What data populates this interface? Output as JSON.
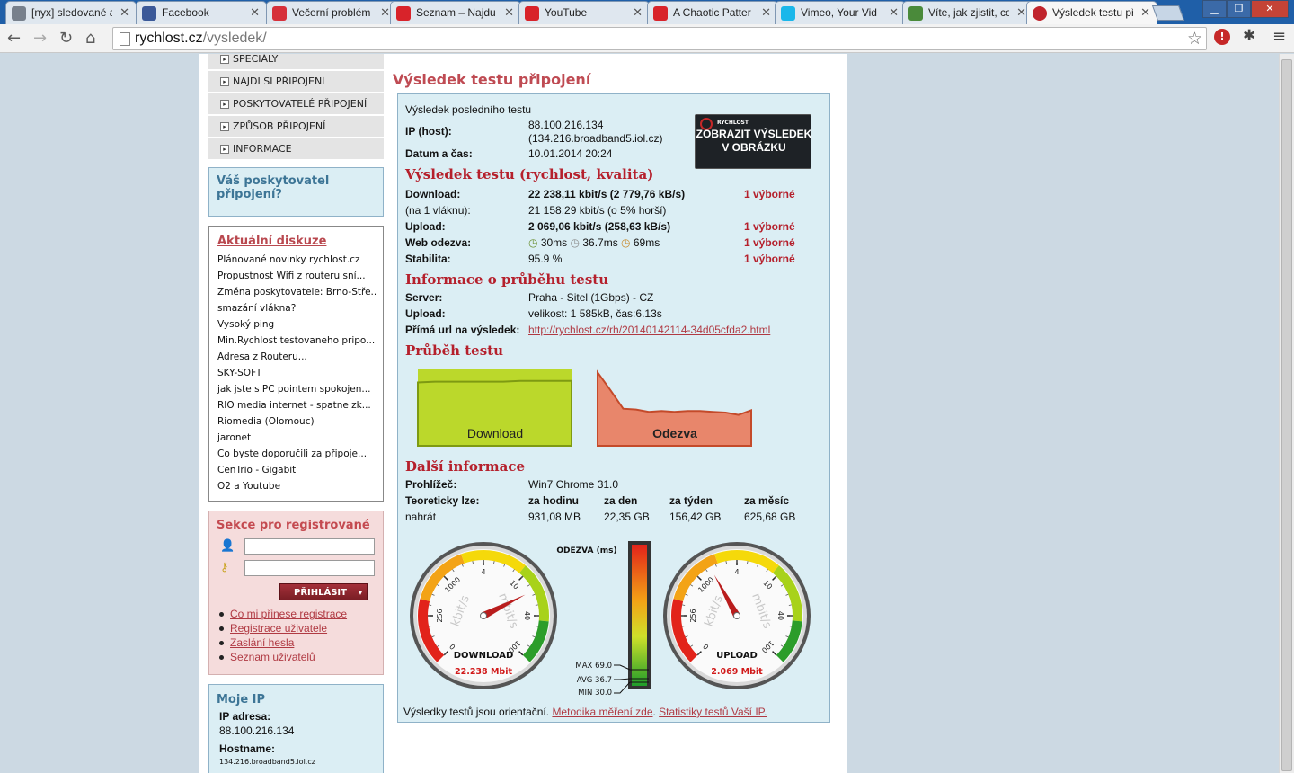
{
  "browser": {
    "tabs": [
      {
        "title": "[nyx] sledované a",
        "color": "#77808c"
      },
      {
        "title": "Facebook",
        "color": "#3b5998"
      },
      {
        "title": "Večerní problém",
        "color": "#d6303a"
      },
      {
        "title": "Seznam – Najdu",
        "color": "#d8232a"
      },
      {
        "title": "YouTube",
        "color": "#d8232a"
      },
      {
        "title": "A Chaotic Patter",
        "color": "#d8232a"
      },
      {
        "title": "Vimeo, Your Vid",
        "color": "#1ab7ea"
      },
      {
        "title": "Víte, jak zjistit, co",
        "color": "#4a8a3a"
      },
      {
        "title": "Výsledek testu př",
        "color": "#c0242c"
      }
    ],
    "url_host": "rychlost.cz",
    "url_path": "/vysledek/"
  },
  "sidebar": {
    "menu": [
      "SPECIÁLY",
      "NAJDI SI PŘIPOJENÍ",
      "POSKYTOVATELÉ PŘIPOJENÍ",
      "ZPŮSOB PŘIPOJENÍ",
      "INFORMACE"
    ],
    "provider_title": "Váš poskytovatel připojení?",
    "discussions_title": "Aktuální diskuze",
    "discussions": [
      "Plánované novinky rychlost.cz",
      "Propustnost Wifi z routeru sní...",
      "Změna poskytovatele: Brno-Stře...",
      "smazání vlákna?",
      "Vysoký ping",
      "Min.Rychlost testovaneho pripo...",
      "Adresa z Routeru...",
      "SKY-SOFT",
      "jak jste s PC pointem spokojen...",
      "RIO media internet - spatne zk...",
      "Riomedia (Olomouc)",
      "jaronet",
      "Co byste doporučili za připoje...",
      "CenTrio - Gigabit",
      "O2 a Youtube"
    ],
    "reg_title": "Sekce pro registrované",
    "login_label": "PŘIHLÁSIT",
    "reg_links": [
      "Co mi přinese registrace",
      "Registrace uživatele",
      "Zaslání hesla",
      "Seznam uživatelů"
    ],
    "myip_title": "Moje IP",
    "ip_label": "IP adresa:",
    "ip_value": "88.100.216.134",
    "host_label": "Hostname:",
    "host_value": "134.216.broadband5.iol.cz"
  },
  "result": {
    "title": "Výsledek testu připojení",
    "last_test": "Výsledek posledního testu",
    "ip_label": "IP (host):",
    "ip_value": "88.100.216.134",
    "host_value": "(134.216.broadband5.iol.cz)",
    "date_label": "Datum a čas:",
    "date_value": "10.01.2014 20:24",
    "badge_text1": "ZOBRAZIT VÝSLEDEK",
    "badge_text2": "V OBRÁZKU",
    "speed_title": "Výsledek testu (rychlost, kvalita)",
    "download_label": "Download:",
    "download_value": "22 238,11 kbit/s (2 779,76 kB/s)",
    "download_rating": "1 výborné",
    "thread_label": "(na 1 vláknu):",
    "thread_value": "21 158,29 kbit/s (o 5% horší)",
    "upload_label": "Upload:",
    "upload_value": "2 069,06 kbit/s (258,63 kB/s)",
    "upload_rating": "1 výborné",
    "web_label": "Web odezva:",
    "web_values": [
      "30ms",
      "36.7ms",
      "69ms"
    ],
    "web_rating": "1 výborné",
    "stab_label": "Stabilita:",
    "stab_value": "95.9 %",
    "stab_rating": "1 výborné",
    "info_title": "Informace o průběhu testu",
    "server_label": "Server:",
    "server_value": "Praha - Sitel (1Gbps) - CZ",
    "upload2_label": "Upload:",
    "upload2_value": "velikost: 1 585kB, čas:6.13s",
    "url_label": "Přímá url na výsledek:",
    "url_value": "http://rychlost.cz/rh/20140142114-34d05cfda2.html",
    "progress_title": "Průběh testu",
    "chart_download_label": "Download",
    "chart_ping_label": "Odezva",
    "more_title": "Další informace",
    "browser_label": "Prohlížeč:",
    "browser_value": "Win7 Chrome 31.0",
    "theory_label": "Teoreticky lze:",
    "upload_verb": "nahrát",
    "periods": [
      "za hodinu",
      "za den",
      "za týden",
      "za měsíc"
    ],
    "period_values": [
      "931,08 MB",
      "22,35 GB",
      "156,42 GB",
      "625,68 GB"
    ],
    "footer_text": "Výsledky testů jsou orientační.",
    "footer_link1": "Metodika měření zde",
    "footer_link2": "Statistiky testů Vaší IP."
  },
  "chart_data": [
    {
      "type": "area",
      "title": "",
      "series": [
        {
          "name": "Download",
          "values": [
            0.82,
            0.83,
            0.83,
            0.83,
            0.83,
            0.83,
            0.84,
            0.84,
            0.84,
            0.84
          ]
        }
      ],
      "ylim": [
        0,
        1
      ]
    },
    {
      "type": "area",
      "title": "",
      "series": [
        {
          "name": "Odezva",
          "values": [
            0.95,
            0.72,
            0.48,
            0.47,
            0.44,
            0.45,
            0.44,
            0.45,
            0.45,
            0.44,
            0.43,
            0.4,
            0.46
          ]
        }
      ],
      "ylim": [
        0,
        1
      ]
    }
  ],
  "gauges": {
    "ticks": [
      "0",
      "256",
      "1000",
      "4",
      "10",
      "40",
      "100"
    ],
    "kbit_label": "kbit/s",
    "mbit_label": "mbit/s",
    "download_title": "DOWNLOAD",
    "download_reading": "22.238 Mbit",
    "download_mbit": 22.238,
    "upload_title": "UPLOAD",
    "upload_reading": "2.069 Mbit",
    "upload_mbit": 2.069
  },
  "ping_meter": {
    "title": "ODEZVA (ms)",
    "max_label": "MAX 69.0",
    "avg_label": "AVG 36.7",
    "min_label": "MIN 30.0"
  }
}
